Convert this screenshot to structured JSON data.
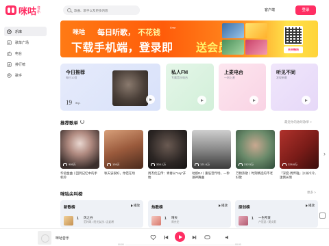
{
  "header": {
    "logo_text": "咪咕",
    "logo_sub": "音乐",
    "search_placeholder": "歌曲、歌手以及更多内容",
    "client_label": "客户端",
    "login_label": "登录"
  },
  "sidebar": {
    "items": [
      {
        "label": "乐库",
        "icon": "library-icon",
        "active": true
      },
      {
        "label": "歌单广场",
        "icon": "playlist-square-icon",
        "active": false
      },
      {
        "label": "电台",
        "icon": "radio-icon",
        "active": false
      },
      {
        "label": "排行榜",
        "icon": "ranking-icon",
        "active": false
      },
      {
        "label": "歌手",
        "icon": "singer-icon",
        "active": false
      }
    ]
  },
  "banner": {
    "logo": "咪咕",
    "line1_a": "每日听歌，",
    "line1_b": "不花钱",
    "line1_small": "Free",
    "line2_a": "下载手机端，登录即",
    "line2_b": "送会员",
    "qr_label": "天天畅听"
  },
  "cards": [
    {
      "title": "今日推荐",
      "subtitle": "每日10首",
      "date_day": "19",
      "date_month": "Sep."
    },
    {
      "title": "私人FM",
      "subtitle": "专属音乐电台"
    },
    {
      "title": "上麦电台",
      "subtitle": "一刻上麦"
    },
    {
      "title": "听见不同",
      "subtitle": "发现新歌"
    }
  ],
  "playlists_section": {
    "title": "推荐歌单",
    "more": "最近你的收听歌单 >"
  },
  "playlists": [
    {
      "count": "905万",
      "title": "华语金曲丨回到记忆中的手机铃"
    },
    {
      "count": "139万",
      "title": "秋天该很好，你若在场"
    },
    {
      "count": "328.1万",
      "title": "周杰伦正传：青春从\"Jay\"开始"
    },
    {
      "count": "121.6万",
      "title": "动感DJ丨重低音炸场，一秒进神舞曲"
    },
    {
      "count": "312.5万",
      "title": "万物热歌丨时刻精选的不老好歌"
    },
    {
      "count": "228.8万",
      "title": "「深度·周传雄」沙洲冷冷，迷倒长情"
    }
  ],
  "charts_section": {
    "title": "咪咕尖叫榜",
    "more": "更多 >"
  },
  "charts": [
    {
      "name": "新歌榜",
      "play": "播放",
      "rank": "1",
      "song": "风之谷",
      "artist": "范玮琪 / 阳光女孩 / 云起希"
    },
    {
      "name": "热歌榜",
      "play": "播放",
      "rank": "1",
      "song": "晴天",
      "artist": "周杰伦"
    },
    {
      "name": "原创榜",
      "play": "播放",
      "rank": "1",
      "song": "一生所爱",
      "artist": "卢冠廷 / 莫文蔚"
    }
  ],
  "player": {
    "title": "咪咕音乐",
    "time_current": "00:00",
    "time_total": "00:00"
  },
  "colors": {
    "brand": "#ff2e63",
    "banner_start": "#ff7a14",
    "banner_end": "#ffd43a"
  }
}
